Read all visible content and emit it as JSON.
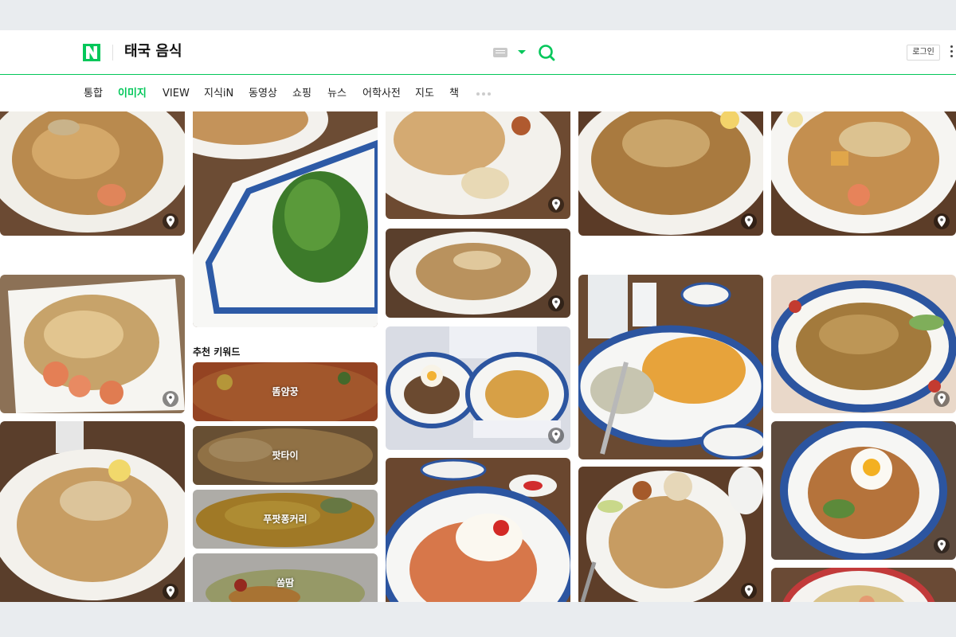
{
  "header": {
    "logo": "N",
    "query": "태국 음식",
    "login_label": "로그인"
  },
  "tabs": [
    {
      "label": "통합",
      "active": false
    },
    {
      "label": "이미지",
      "active": true
    },
    {
      "label": "VIEW",
      "active": false
    },
    {
      "label": "지식iN",
      "active": false
    },
    {
      "label": "동영상",
      "active": false
    },
    {
      "label": "쇼핑",
      "active": false
    },
    {
      "label": "뉴스",
      "active": false
    },
    {
      "label": "어학사전",
      "active": false
    },
    {
      "label": "지도",
      "active": false
    },
    {
      "label": "책",
      "active": false
    }
  ],
  "recommend": {
    "heading": "추천 키워드",
    "keywords": [
      "똠얌꿍",
      "팟타이",
      "푸팟퐁커리",
      "쏨땀"
    ]
  },
  "icons": {
    "logo": "naver-n-logo",
    "keyboard": "keyboard-icon",
    "dropdown": "chevron-down-icon",
    "search": "search-icon",
    "more": "more-vertical-icon",
    "tab_more": "more-horizontal-icon",
    "pin": "location-pin-icon"
  },
  "colors": {
    "brand_green": "#03c75a",
    "page_bg": "#e9ecef"
  }
}
